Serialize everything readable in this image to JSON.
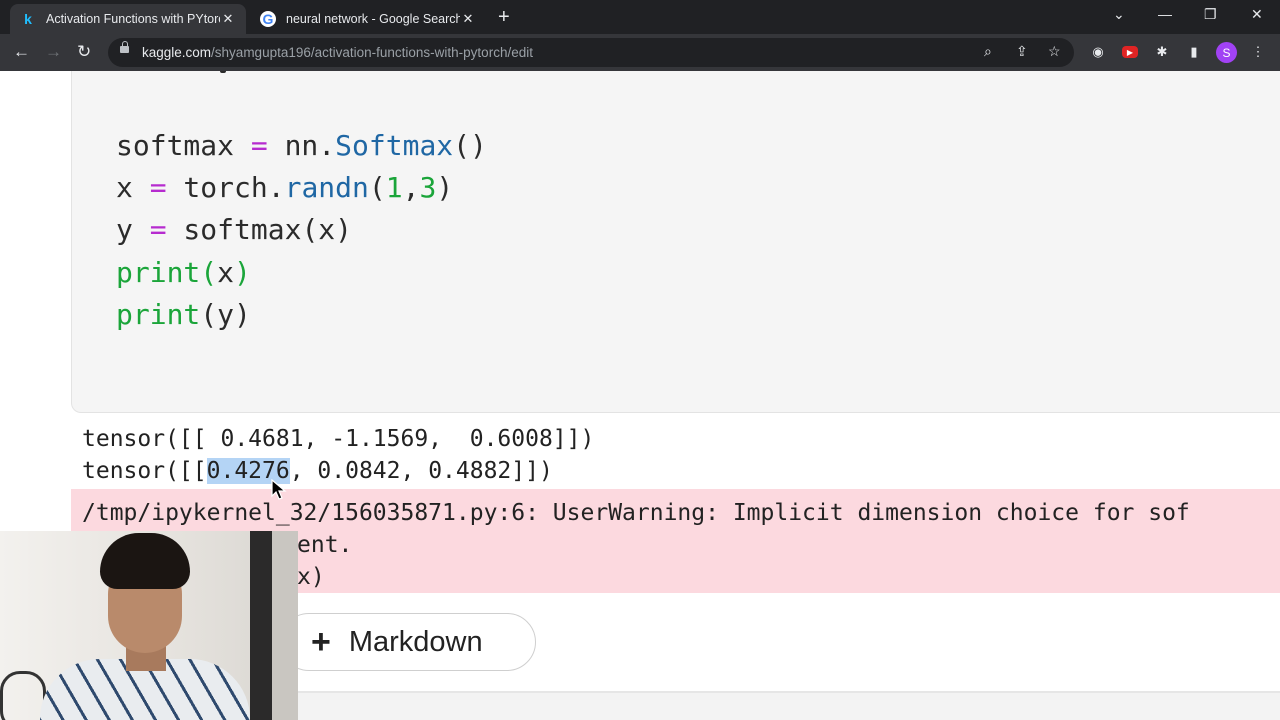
{
  "browser": {
    "tabs": [
      {
        "title": "Activation Functions with PYtorch",
        "favicon": "k",
        "active": true
      },
      {
        "title": "neural network - Google Search",
        "favicon": "G",
        "active": false
      }
    ],
    "url_host": "kaggle.com",
    "url_path": "/shyamgupta196/activation-functions-with-pytorch/edit",
    "profile_initial": "S"
  },
  "code_cell": {
    "lines": [
      [
        {
          "t": "softmax ",
          "c": ""
        },
        {
          "t": "=",
          "c": "kw-op"
        },
        {
          "t": " nn.",
          "c": ""
        },
        {
          "t": "Softmax",
          "c": "fn"
        },
        {
          "t": "()",
          "c": ""
        }
      ],
      [
        {
          "t": "x ",
          "c": ""
        },
        {
          "t": "=",
          "c": "kw-op"
        },
        {
          "t": " torch.",
          "c": ""
        },
        {
          "t": "randn",
          "c": "fn"
        },
        {
          "t": "(",
          "c": ""
        },
        {
          "t": "1",
          "c": "num"
        },
        {
          "t": ",",
          "c": ""
        },
        {
          "t": "3",
          "c": "num"
        },
        {
          "t": ")",
          "c": ""
        }
      ],
      [
        {
          "t": "y ",
          "c": ""
        },
        {
          "t": "=",
          "c": "kw-op"
        },
        {
          "t": " softmax(x)",
          "c": ""
        }
      ],
      [
        {
          "t": "print",
          "c": "builtin"
        },
        {
          "t": "(",
          "c": "builtin"
        },
        {
          "t": "x",
          "c": ""
        },
        {
          "t": ")",
          "c": "builtin"
        }
      ],
      [
        {
          "t": "print",
          "c": "builtin"
        },
        {
          "t": "(y)",
          "c": ""
        }
      ]
    ]
  },
  "output": {
    "line1": "tensor([[ 0.4681, -1.1569,  0.6008]])",
    "line2_prefix": "tensor([[",
    "line2_selected": "0.4276",
    "line2_suffix": ", 0.0842, 0.4882]])"
  },
  "warning": {
    "line1": "/tmp/ipykernel_32/156035871.py:6: UserWarning: Implicit dimension choice for sof",
    "line2": "ent.",
    "line3": "x)"
  },
  "add_markdown": {
    "plus": "+",
    "label": "Markdown"
  },
  "colors": {
    "keyword_op": "#b62bcf",
    "function": "#1f67a4",
    "builtin_and_number": "#1ba53a",
    "warning_bg": "#fcd9df",
    "selection": "#b4d4f5"
  }
}
